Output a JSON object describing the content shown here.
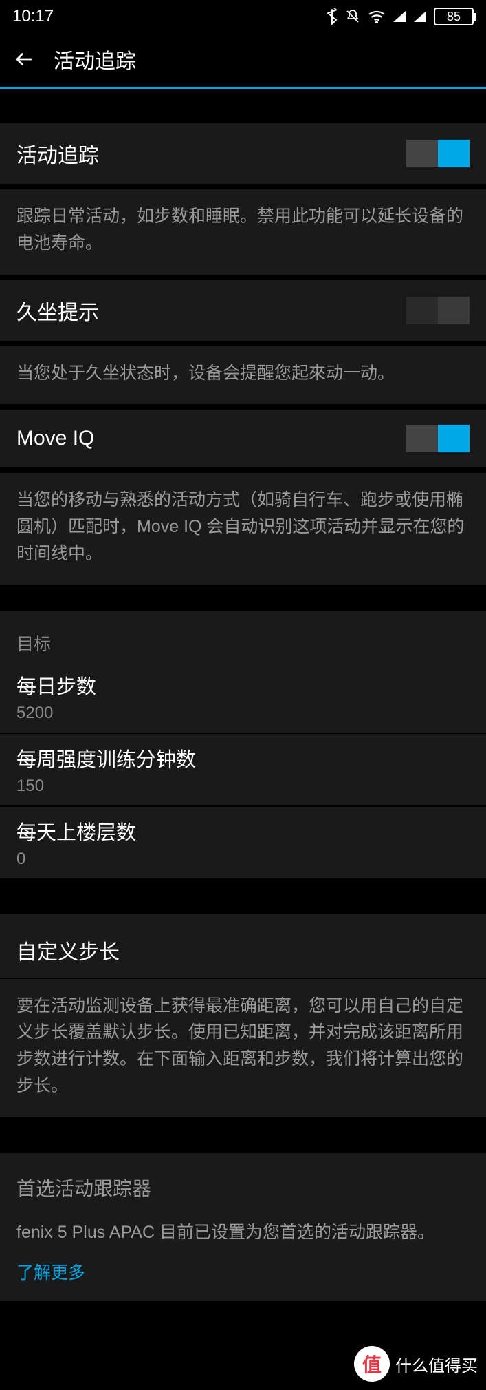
{
  "status": {
    "time": "10:17",
    "battery": "85"
  },
  "header": {
    "title": "活动追踪"
  },
  "settings": {
    "activity_tracking": {
      "label": "活动追踪",
      "desc": "跟踪日常活动，如步数和睡眠。禁用此功能可以延长设备的电池寿命。",
      "on": true
    },
    "sedentary": {
      "label": "久坐提示",
      "desc": "当您处于久坐状态时，设备会提醒您起來动一动。",
      "on": false
    },
    "moveiq": {
      "label": "Move IQ",
      "desc": "当您的移动与熟悉的活动方式（如骑自行车、跑步或使用椭圆机）匹配时，Move IQ 会自动识别这项活动并显示在您的时间线中。",
      "on": true
    }
  },
  "goals": {
    "header": "目标",
    "daily_steps": {
      "label": "每日步数",
      "value": "5200"
    },
    "intensity_minutes": {
      "label": "每周强度训练分钟数",
      "value": "150"
    },
    "floors": {
      "label": "每天上楼层数",
      "value": "0"
    }
  },
  "stride": {
    "title": "自定义步长",
    "desc": "要在活动监测设备上获得最准确距离，您可以用自己的自定义步长覆盖默认步长。使用已知距离，并对完成该距离所用步数进行计数。在下面输入距离和步数，我们将计算出您的步长。"
  },
  "tracker": {
    "title": "首选活动跟踪器",
    "desc": "fenix 5 Plus APAC 目前已设置为您首选的活动跟踪器。",
    "link": "了解更多"
  },
  "watermark": {
    "badge": "值",
    "text": "什么值得买"
  }
}
